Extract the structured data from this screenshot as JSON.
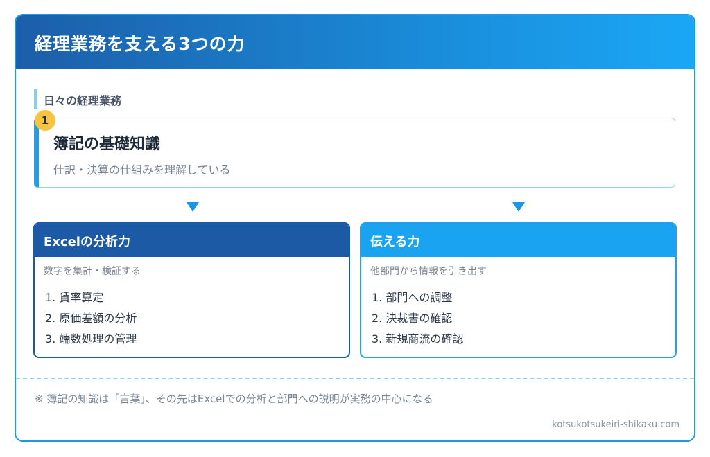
{
  "header": {
    "title": "経理業務を支える3つの力"
  },
  "section_label": "日々の経理業務",
  "step": {
    "badge": "1",
    "title": "簿記の基礎知識",
    "description": "仕訳・決算の仕組みを理解している"
  },
  "panels": [
    {
      "title": "Excelの分析力",
      "subtitle": "数字を集計・検証する",
      "items": [
        "1. 賃率算定",
        "2. 原価差額の分析",
        "3. 端数処理の管理"
      ],
      "color": "#1d5aa5"
    },
    {
      "title": "伝える力",
      "subtitle": "他部門から情報を引き出す",
      "items": [
        "1. 部門への調整",
        "2. 決裁書の確認",
        "3. 新規商流の確認"
      ],
      "color": "#1aa3f0"
    }
  ],
  "note": "※ 簿記の知識は「言葉」、その先はExcelでの分析と部門への説明が実務の中心になる",
  "source": "kotsukotsukeiri-shikaku.com",
  "colors": {
    "accent": "#1a96e8",
    "badge": "#f6c343",
    "dark_blue": "#1d5aa5"
  }
}
